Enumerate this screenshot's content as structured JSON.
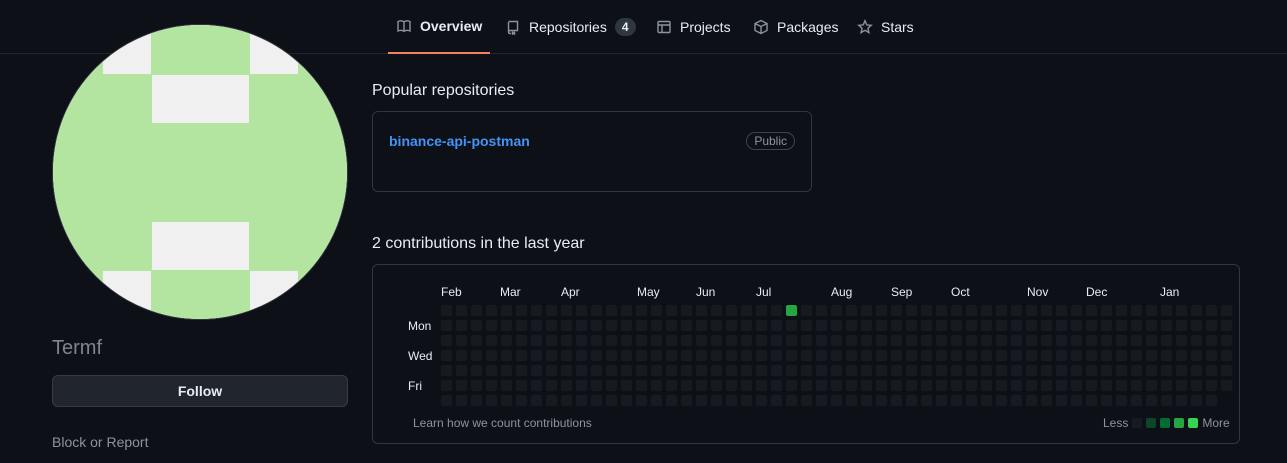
{
  "nav": {
    "tabs": [
      {
        "label": "Overview",
        "icon": "book-icon",
        "active": true
      },
      {
        "label": "Repositories",
        "icon": "repo-icon",
        "count": "4"
      },
      {
        "label": "Projects",
        "icon": "table-icon"
      },
      {
        "label": "Packages",
        "icon": "package-icon"
      },
      {
        "label": "Stars",
        "icon": "star-icon"
      }
    ]
  },
  "profile": {
    "username": "Termf",
    "follow_label": "Follow",
    "block_label": "Block or Report",
    "avatar_colors": {
      "fill": "#b3e5a1",
      "background": "#f0f0f0"
    }
  },
  "popular": {
    "title": "Popular repositories",
    "repos": [
      {
        "name": "binance-api-postman",
        "visibility": "Public"
      }
    ]
  },
  "contributions": {
    "title": "2 contributions in the last year",
    "months": [
      "Feb",
      "Mar",
      "Apr",
      "May",
      "Jun",
      "Jul",
      "Aug",
      "Sep",
      "Oct",
      "Nov",
      "Dec",
      "Jan"
    ],
    "days": [
      "Mon",
      "Wed",
      "Fri"
    ],
    "weeks": 53,
    "active_cells": [
      {
        "week": 23,
        "day": 0,
        "level": 3
      }
    ],
    "learn_label": "Learn how we count contributions",
    "legend": {
      "less": "Less",
      "more": "More"
    },
    "colors": [
      "#161b22",
      "#0e4429",
      "#006d32",
      "#26a641",
      "#39d353"
    ]
  }
}
